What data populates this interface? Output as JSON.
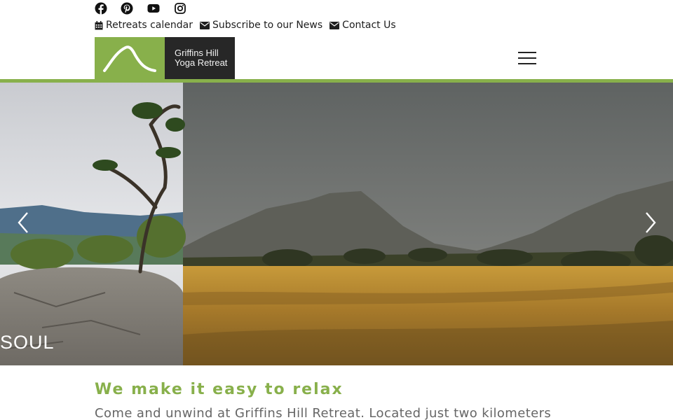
{
  "social": [
    {
      "icon": "facebook-icon"
    },
    {
      "icon": "pinterest-icon"
    },
    {
      "icon": "youtube-icon"
    },
    {
      "icon": "instagram-icon"
    }
  ],
  "utility_links": {
    "calendar": {
      "icon": "calendar-icon",
      "label": "Retreats calendar"
    },
    "subscribe": {
      "icon": "envelope-icon",
      "label": "Subscribe to our News"
    },
    "contact": {
      "icon": "envelope-icon",
      "label": "Contact Us"
    }
  },
  "logo": {
    "line1": "Griffins Hill",
    "line2": "Yoga Retreat",
    "brand_green": "#88b04b",
    "brand_dark": "#272727"
  },
  "menu": {
    "icon": "hamburger-menu-icon"
  },
  "hero": {
    "caption": "SOUL",
    "prev_icon": "chevron-left-icon",
    "next_icon": "chevron-right-icon"
  },
  "intro": {
    "heading": "We make it easy to relax",
    "body": "Come and unwind at Griffins Hill Retreat. Located just two kilometers"
  }
}
